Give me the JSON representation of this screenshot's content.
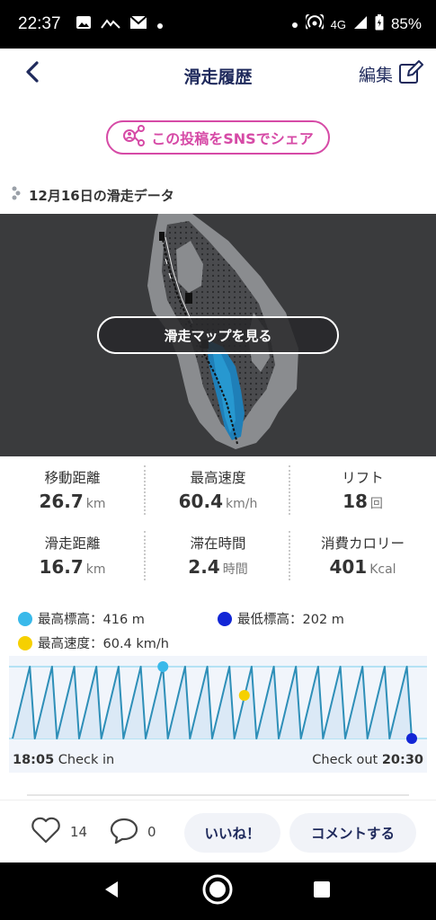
{
  "status_bar": {
    "time": "22:37",
    "network": "4G",
    "battery": "85%",
    "left_icons": [
      "image-icon",
      "mountain-icon",
      "mail-icon",
      "dot-icon"
    ],
    "right_icons": [
      "dot-icon",
      "hotspot-icon",
      "signal-icon",
      "battery-icon"
    ]
  },
  "header": {
    "title": "滑走履歴",
    "edit_label": "編集"
  },
  "share": {
    "label": "この投稿をSNSでシェア"
  },
  "section": {
    "label": "12月16日の滑走データ"
  },
  "map": {
    "button_label": "滑走マップを見る"
  },
  "stats": [
    {
      "label": "移動距離",
      "value": "26.7",
      "unit": "km"
    },
    {
      "label": "最高速度",
      "value": "60.4",
      "unit": "km/h"
    },
    {
      "label": "リフト",
      "value": "18",
      "unit": "回"
    },
    {
      "label": "滑走距離",
      "value": "16.7",
      "unit": "km"
    },
    {
      "label": "滞在時間",
      "value": "2.4",
      "unit": "時間"
    },
    {
      "label": "消費カロリー",
      "value": "401",
      "unit": "Kcal"
    }
  ],
  "legend": {
    "max_elevation": "最高標高：416 m",
    "min_elevation": "最低標高：202 m",
    "max_speed": "最高速度：60.4 km/h"
  },
  "colors": {
    "accent_navy": "#1f2a5c",
    "share_pink": "#d64aa6",
    "max_elevation": "#39b9ea",
    "min_elevation": "#1226d6",
    "max_speed": "#f6d000",
    "line": "#2e8fb8"
  },
  "chart_data": {
    "type": "line",
    "title": "",
    "xlabel": "",
    "ylabel": "",
    "series": [],
    "cycles": 18,
    "ylim": [
      202,
      416
    ],
    "markers": [
      {
        "name": "最高標高",
        "y": 416
      },
      {
        "name": "最低標高",
        "y": 202
      },
      {
        "name": "最高速度",
        "y": 60.4
      }
    ]
  },
  "checkin": {
    "time": "18:05",
    "label": "Check in"
  },
  "checkout": {
    "time": "20:30",
    "label": "Check out"
  },
  "actions": {
    "like_count": "14",
    "comment_count": "0",
    "like_button": "いいね！",
    "comment_button": "コメントする"
  }
}
